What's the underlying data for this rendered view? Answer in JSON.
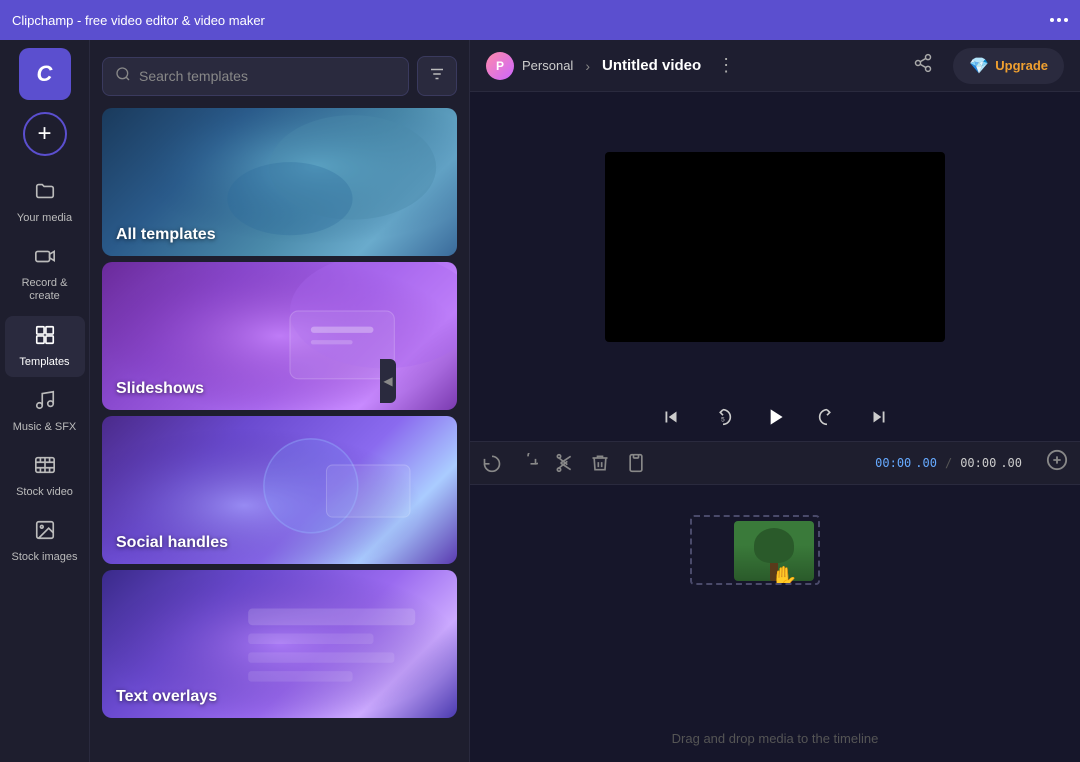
{
  "topbar": {
    "title": "Clipchamp - free video editor & video maker",
    "more_icon": "more-icon"
  },
  "sidebar": {
    "logo_letter": "C",
    "add_label": "+",
    "items": [
      {
        "id": "your-media",
        "icon": "📁",
        "label": "Your media",
        "active": false
      },
      {
        "id": "record-create",
        "icon": "🎬",
        "label": "Record & create",
        "active": false
      },
      {
        "id": "templates",
        "icon": "⊞",
        "label": "Templates",
        "active": true
      },
      {
        "id": "music-sfx",
        "icon": "🎵",
        "label": "Music & SFX",
        "active": false
      },
      {
        "id": "stock-video",
        "icon": "🎞",
        "label": "Stock video",
        "active": false
      },
      {
        "id": "stock-images",
        "icon": "🖼",
        "label": "Stock images",
        "active": false
      }
    ]
  },
  "search": {
    "placeholder": "Search templates",
    "filter_label": "≡"
  },
  "templates": {
    "cards": [
      {
        "id": "all-templates",
        "label": "All templates",
        "bg_class": "bg-all-templates"
      },
      {
        "id": "slideshows",
        "label": "Slideshows",
        "bg_class": "bg-slideshows"
      },
      {
        "id": "social-handles",
        "label": "Social handles",
        "bg_class": "bg-social"
      },
      {
        "id": "text-overlays",
        "label": "Text overlays",
        "bg_class": "bg-text-overlays"
      }
    ]
  },
  "header": {
    "personal_label": "Personal",
    "breadcrumb_arrow": "›",
    "video_title": "Untitled video",
    "upgrade_label": "Upgrade",
    "diamond_icon": "💎"
  },
  "playback": {
    "skip_back_icon": "⏮",
    "rewind_icon": "↺",
    "play_icon": "▶",
    "forward_icon": "↻",
    "skip_forward_icon": "⏭"
  },
  "timeline": {
    "undo_icon": "↩",
    "redo_icon": "↪",
    "cut_icon": "✂",
    "delete_icon": "🗑",
    "lock_icon": "📋",
    "current_time": "00:00",
    "current_ms": ".00",
    "separator": "/",
    "total_time": "00:00",
    "total_ms": ".00",
    "add_icon": "+",
    "drop_hint": "Drag and drop media to the timeline"
  },
  "collapse": {
    "icon": "◀"
  }
}
